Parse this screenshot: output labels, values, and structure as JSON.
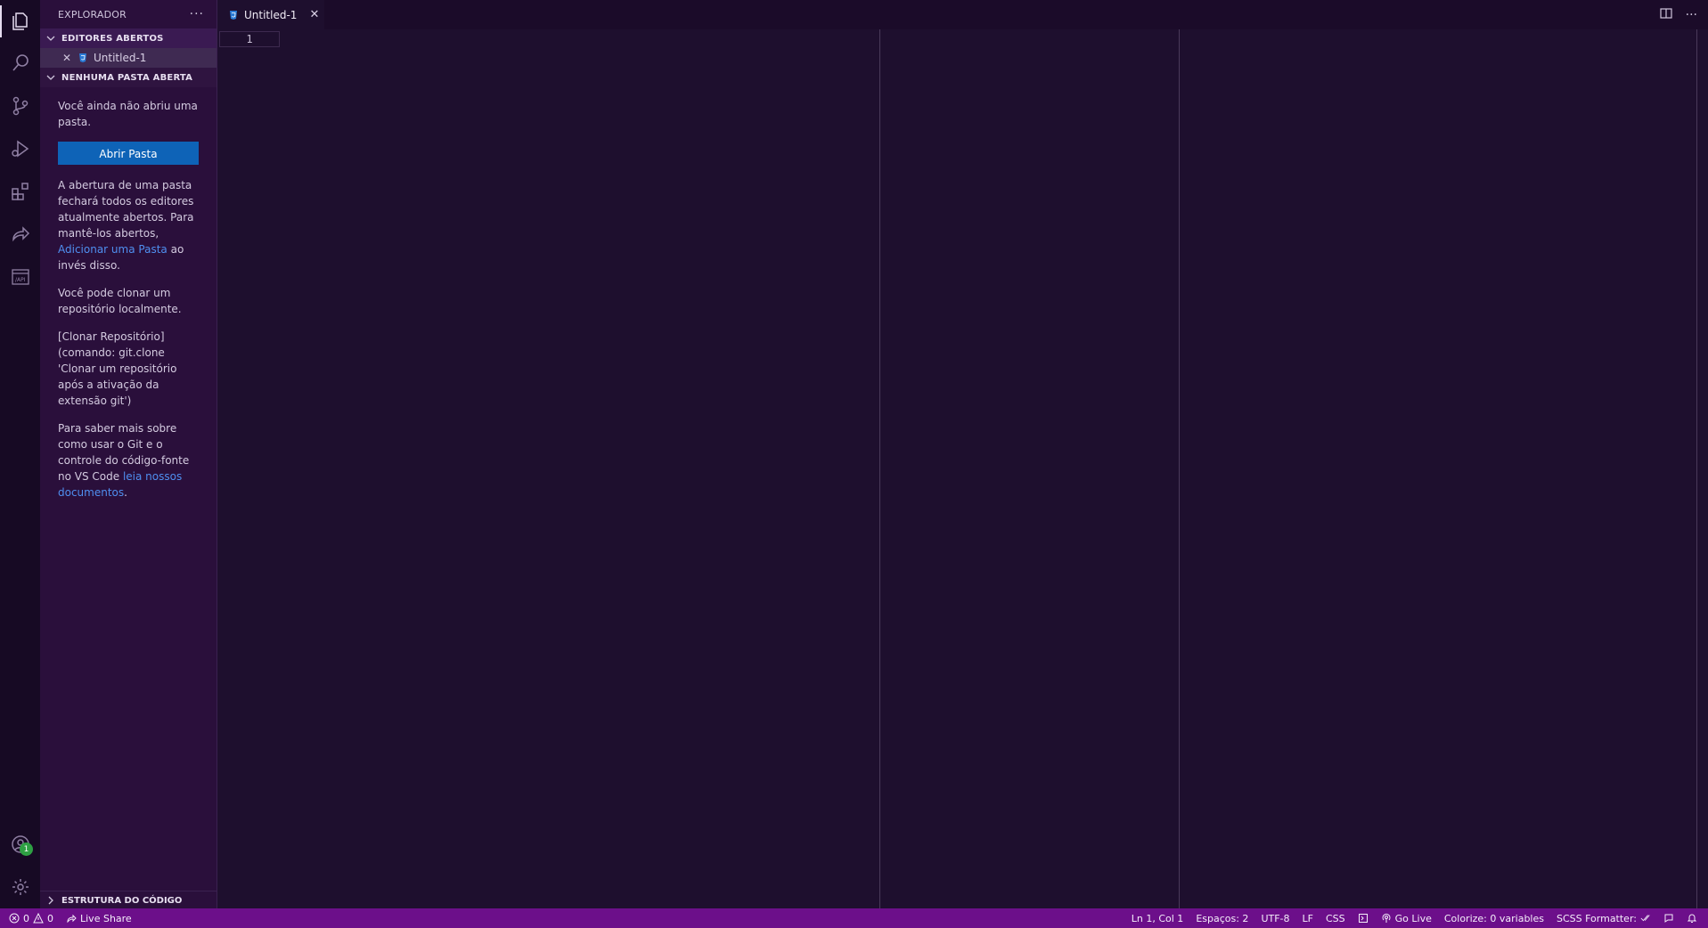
{
  "sidebar": {
    "title": "EXPLORADOR",
    "more": "···",
    "open_editors_header": "EDITORES ABERTOS",
    "open_editors": [
      {
        "name": "Untitled-1",
        "close": "✕"
      }
    ],
    "no_folder_header": "NENHUMA PASTA ABERTA",
    "welcome": {
      "p1": "Você ainda não abriu uma pasta.",
      "open_folder_button": "Abrir Pasta",
      "p2_before": "A abertura de uma pasta fechará todos os editores atualmente abertos. Para mantê-los abertos,",
      "p2_link": "Adicionar uma Pasta",
      "p2_after": "ao invés disso.",
      "p3": "Você pode clonar um repositório localmente.",
      "p4": "[Clonar Repositório] (comando: git.clone 'Clonar um repositório após a ativação da extensão git')",
      "p5_before": "Para saber mais sobre como usar o Git e o controle do código-fonte no VS Code",
      "p5_link": "leia nossos documentos",
      "p5_after": "."
    },
    "outline_header": "ESTRUTURA DO CÓDIGO"
  },
  "tabs": [
    {
      "label": "Untitled-1",
      "close": "✕"
    }
  ],
  "editor": {
    "line_number": "1"
  },
  "accounts_badge": "1",
  "statusbar": {
    "errors": "0",
    "warnings": "0",
    "live_share": "Live Share",
    "position": "Ln 1, Col 1",
    "spaces": "Espaços: 2",
    "encoding": "UTF-8",
    "eol": "LF",
    "language": "CSS",
    "go_live": "Go Live",
    "colorize": "Colorize: 0 variables",
    "scss_formatter": "SCSS Formatter:"
  },
  "colors": {
    "editor_bg": "#1e0f2e",
    "sidebar_bg": "#2a0f3b",
    "statusbar_bg": "#6c0f8a",
    "button_bg": "#0e63b7",
    "link": "#4f8ff0"
  }
}
